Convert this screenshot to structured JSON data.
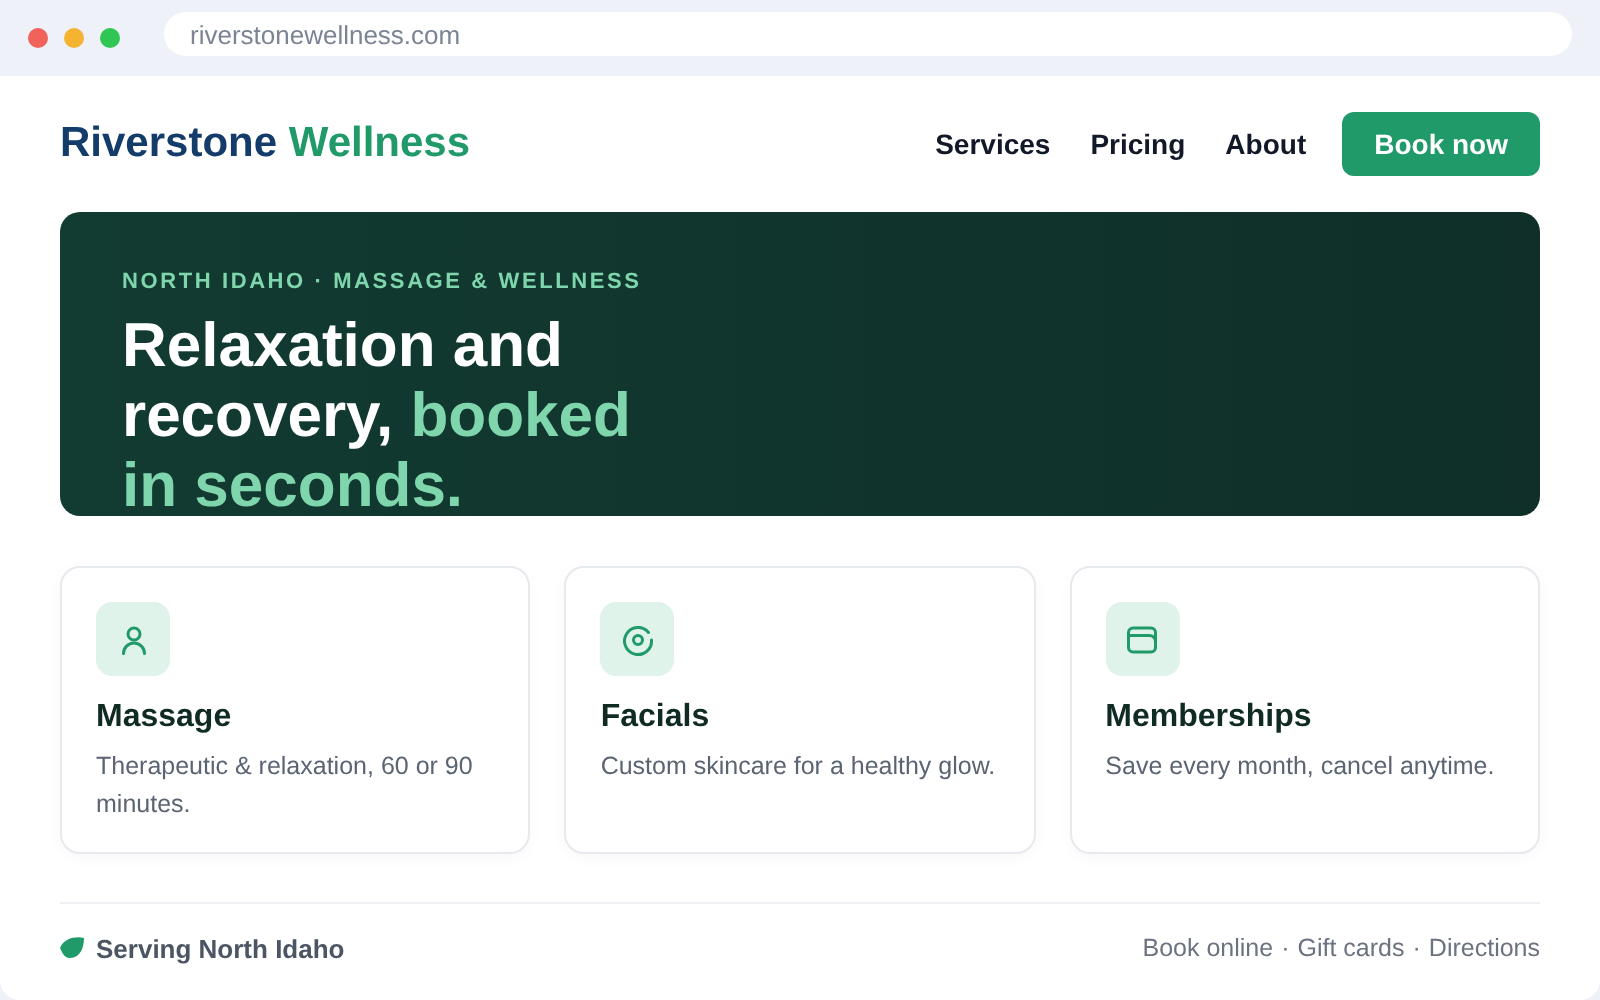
{
  "browser": {
    "url": "riverstonewellness.com"
  },
  "header": {
    "brand": [
      "Riverstone",
      "Wellness"
    ],
    "nav": [
      "Services",
      "Pricing",
      "About"
    ],
    "cta": "Book now"
  },
  "hero": {
    "eyebrow": "NORTH IDAHO · MASSAGE & WELLNESS",
    "headline": "Relaxation and recovery, ",
    "highlight": "booked in seconds."
  },
  "services": [
    {
      "title": "Massage",
      "text": "Therapeutic & relaxation, 60 or 90 minutes."
    },
    {
      "title": "Facials",
      "text": "Custom skincare for a healthy glow."
    },
    {
      "title": "Memberships",
      "text": "Save every month, cancel anytime."
    }
  ],
  "footer": {
    "tagline": "Serving North Idaho",
    "links": [
      "Book online",
      "Gift cards",
      "Directions"
    ],
    "separator": "·"
  }
}
